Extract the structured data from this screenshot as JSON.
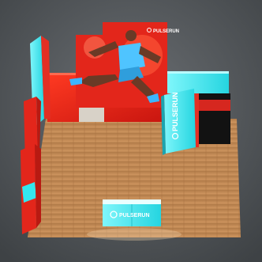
{
  "scene": {
    "brand_text": "PULSERUN",
    "brand_text_rotated": "PULSERUN",
    "counter_text": "PULSERUN",
    "colors": {
      "red": "#e8231c",
      "cyan": "#33e6ee",
      "floor": "#c48a55",
      "concrete": "#5a5e62",
      "black": "#111111"
    }
  }
}
